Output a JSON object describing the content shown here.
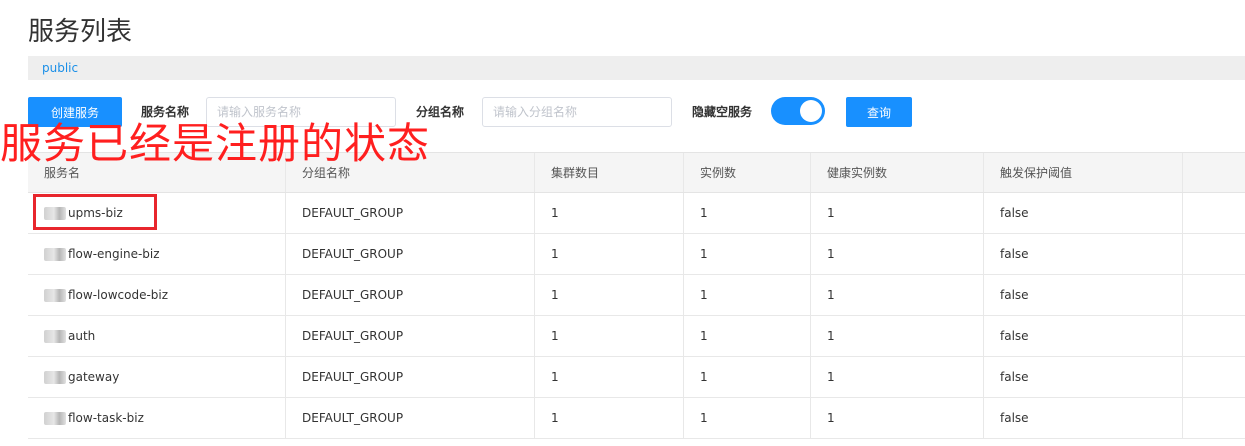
{
  "page": {
    "title": "服务列表",
    "namespace": "public"
  },
  "toolbar": {
    "create_label": "创建服务",
    "service_name_label": "服务名称",
    "service_name_placeholder": "请输入服务名称",
    "group_name_label": "分组名称",
    "group_name_placeholder": "请输入分组名称",
    "hide_empty_label": "隐藏空服务",
    "hide_empty_on": true,
    "query_label": "查询"
  },
  "annotation": {
    "text": "服务已经是注册的状态",
    "color": "#ff1f1f"
  },
  "table": {
    "headers": [
      "服务名",
      "分组名称",
      "集群数目",
      "实例数",
      "健康实例数",
      "触发保护阈值"
    ],
    "rows": [
      {
        "name": "upms-biz",
        "group": "DEFAULT_GROUP",
        "clusters": "1",
        "instances": "1",
        "healthy": "1",
        "protect": "false"
      },
      {
        "name": "flow-engine-biz",
        "group": "DEFAULT_GROUP",
        "clusters": "1",
        "instances": "1",
        "healthy": "1",
        "protect": "false"
      },
      {
        "name": "flow-lowcode-biz",
        "group": "DEFAULT_GROUP",
        "clusters": "1",
        "instances": "1",
        "healthy": "1",
        "protect": "false"
      },
      {
        "name": "auth",
        "group": "DEFAULT_GROUP",
        "clusters": "1",
        "instances": "1",
        "healthy": "1",
        "protect": "false"
      },
      {
        "name": "gateway",
        "group": "DEFAULT_GROUP",
        "clusters": "1",
        "instances": "1",
        "healthy": "1",
        "protect": "false"
      },
      {
        "name": "flow-task-biz",
        "group": "DEFAULT_GROUP",
        "clusters": "1",
        "instances": "1",
        "healthy": "1",
        "protect": "false"
      }
    ]
  },
  "colors": {
    "primary": "#1890ff",
    "link": "#1a8fe8",
    "annotation_red": "#ff1f1f",
    "highlight_box": "#e8262d"
  }
}
